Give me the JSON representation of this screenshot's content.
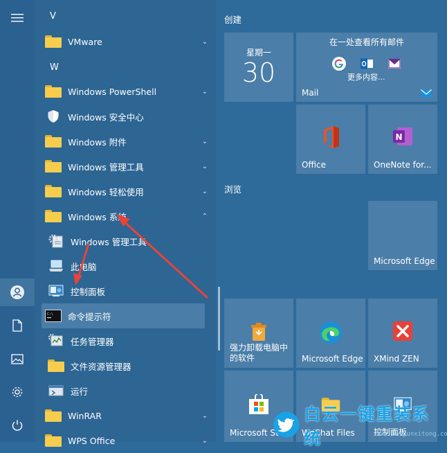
{
  "applist": {
    "letter_v": "V",
    "letter_w": "W",
    "items": [
      {
        "label": "VMware",
        "chev": "⌄"
      },
      {
        "label": "Windows PowerShell",
        "chev": "⌄"
      },
      {
        "label": "Windows 安全中心",
        "chev": ""
      },
      {
        "label": "Windows 附件",
        "chev": "⌄"
      },
      {
        "label": "Windows 管理工具",
        "chev": "⌄"
      },
      {
        "label": "Windows 轻松使用",
        "chev": "⌄"
      },
      {
        "label": "Windows 系统",
        "chev": "⌃"
      },
      {
        "label": "Windows 管理工具"
      },
      {
        "label": "此电脑"
      },
      {
        "label": "控制面板"
      },
      {
        "label": "命令提示符"
      },
      {
        "label": "任务管理器"
      },
      {
        "label": "文件资源管理器"
      },
      {
        "label": "运行"
      },
      {
        "label": "WinRAR",
        "chev": "⌄"
      },
      {
        "label": "WPS Office",
        "chev": "⌄"
      }
    ]
  },
  "tiles": {
    "section_create": "创建",
    "section_browse": "浏览",
    "calendar": {
      "weekday": "星期一",
      "day": "30"
    },
    "mail": {
      "title": "在一处查看所有邮件",
      "more": "更多内容...",
      "label": "Mail"
    },
    "office": {
      "label": "Office"
    },
    "onenote": {
      "label": "OneNote for..."
    },
    "edge_large": {
      "label": "Microsoft Edge"
    },
    "uninstall": {
      "label": "强力卸载电脑中的软件"
    },
    "edge": {
      "label": "Microsoft Edge"
    },
    "xmind": {
      "label": "XMind ZEN"
    },
    "store": {
      "label": "Microsoft St"
    },
    "wechat": {
      "label": "WeChat Files"
    },
    "control_panel": {
      "label": "控制面板"
    }
  },
  "watermark": {
    "text": "白云一键重装系统",
    "url": "www.baiyunxitong.com"
  },
  "colors": {
    "accent": "#2e6a9a",
    "tile": "#4b7ea8",
    "highlight": "#4a7ea8",
    "arrow": "#e8443a"
  }
}
